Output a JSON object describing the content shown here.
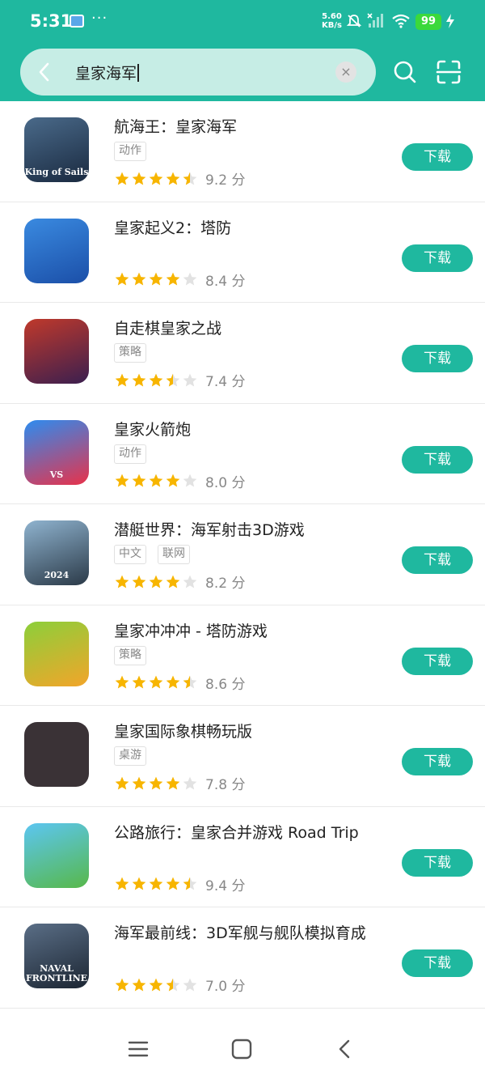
{
  "status_bar": {
    "time": "5:31",
    "speed_value": "5.60",
    "speed_unit": "KB/s",
    "battery": "99",
    "dots": "···"
  },
  "search": {
    "query": "皇家海军",
    "clear_symbol": "×"
  },
  "download_label": "下载",
  "score_unit": "分",
  "apps": [
    {
      "name": "航海王：皇家海军",
      "tags": [
        "动作"
      ],
      "rating": 4.5,
      "score": "9.2",
      "icon_label": "King of Sails",
      "icon_colors": [
        "#4a6a8a",
        "#1a2a40"
      ]
    },
    {
      "name": "皇家起义2：塔防",
      "tags": [],
      "rating": 4,
      "score": "8.4",
      "icon_label": "",
      "icon_colors": [
        "#3a8ae0",
        "#1b4fa8"
      ]
    },
    {
      "name": "自走棋皇家之战",
      "tags": [
        "策略"
      ],
      "rating": 3.5,
      "score": "7.4",
      "icon_label": "",
      "icon_colors": [
        "#c0392b",
        "#3b1f4f"
      ]
    },
    {
      "name": "皇家火箭炮",
      "tags": [
        "动作"
      ],
      "rating": 4,
      "score": "8.0",
      "icon_label": "VS",
      "icon_colors": [
        "#2d8cf0",
        "#e8324a"
      ]
    },
    {
      "name": "潜艇世界：海军射击3D游戏",
      "tags": [
        "中文",
        "联网"
      ],
      "rating": 4,
      "score": "8.2",
      "icon_label": "2024",
      "icon_colors": [
        "#8fb3cf",
        "#2b3a48"
      ]
    },
    {
      "name": "皇家冲冲冲 - 塔防游戏",
      "tags": [
        "策略"
      ],
      "rating": 4.5,
      "score": "8.6",
      "icon_label": "",
      "icon_colors": [
        "#8ccf3a",
        "#f2a52a"
      ]
    },
    {
      "name": "皇家国际象棋畅玩版",
      "tags": [
        "桌游"
      ],
      "rating": 4,
      "score": "7.8",
      "icon_label": "",
      "icon_colors": [
        "#3a3236",
        "#3a3236"
      ]
    },
    {
      "name": "公路旅行：皇家合并游戏 Road Trip",
      "tags": [],
      "rating": 4.5,
      "score": "9.4",
      "icon_label": "",
      "icon_colors": [
        "#5cc6f2",
        "#57b84a"
      ]
    },
    {
      "name": "海军最前线：3D军舰与舰队模拟育成",
      "tags": [],
      "rating": 3.5,
      "score": "7.0",
      "icon_label": "NAVAL FRONTLINE",
      "icon_colors": [
        "#5a6e86",
        "#1c2633"
      ]
    }
  ],
  "colors": {
    "accent": "#1fb89f",
    "star": "#f7b500",
    "star_empty": "#e2e2e2"
  }
}
